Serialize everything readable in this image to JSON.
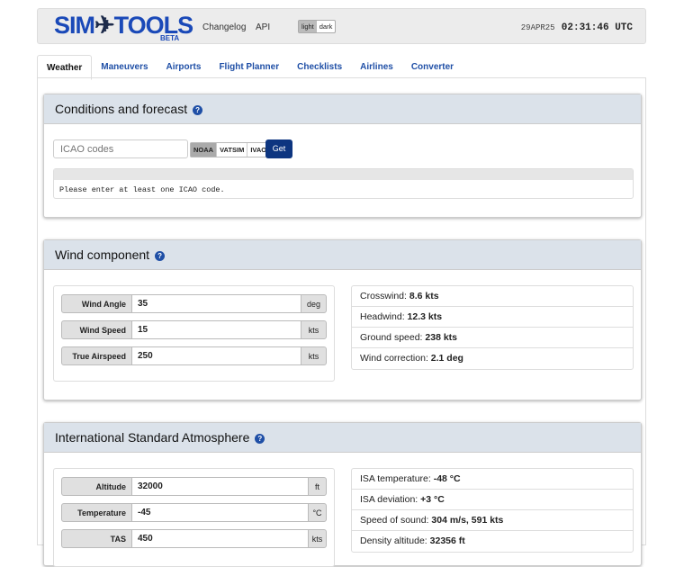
{
  "header": {
    "logo": "SIMTOOLS",
    "logo_left": "SIM",
    "logo_right": "TOOLS",
    "badge": "BETA",
    "nav": [
      "Changelog",
      "API"
    ],
    "theme": [
      "light",
      "dark"
    ],
    "date": "29APR25",
    "time": "02:31:46 UTC"
  },
  "tabs": [
    "Weather",
    "Maneuvers",
    "Airports",
    "Flight Planner",
    "Checklists",
    "Airlines",
    "Converter"
  ],
  "conditions": {
    "title": "Conditions and forecast",
    "help": "?",
    "placeholder": "ICAO codes",
    "sources": [
      "NOAA",
      "VATSIM",
      "IVAO"
    ],
    "get": "Get",
    "message": "Please enter at least one ICAO code."
  },
  "wind": {
    "title": "Wind component",
    "help": "?",
    "inputs": [
      {
        "label": "Wind Angle",
        "value": "35",
        "unit": "deg"
      },
      {
        "label": "Wind Speed",
        "value": "15",
        "unit": "kts"
      },
      {
        "label": "True Airspeed",
        "value": "250",
        "unit": "kts"
      }
    ],
    "results": [
      {
        "label": "Crosswind:",
        "value": "8.6 kts"
      },
      {
        "label": "Headwind:",
        "value": "12.3 kts"
      },
      {
        "label": "Ground speed:",
        "value": "238 kts"
      },
      {
        "label": "Wind correction:",
        "value": "2.1 deg"
      }
    ]
  },
  "isa": {
    "title": "International Standard Atmosphere",
    "help": "?",
    "inputs": [
      {
        "label": "Altitude",
        "value": "32000",
        "unit": "ft"
      },
      {
        "label": "Temperature",
        "value": "-45",
        "unit": "°C"
      },
      {
        "label": "TAS",
        "value": "450",
        "unit": "kts"
      }
    ],
    "results": [
      {
        "label": "ISA temperature:",
        "value": "-48 °C"
      },
      {
        "label": "ISA deviation:",
        "value": "+3 °C"
      },
      {
        "label": "Speed of sound:",
        "value": "304 m/s, 591 kts"
      },
      {
        "label": "Density altitude:",
        "value": "32356 ft"
      }
    ]
  }
}
